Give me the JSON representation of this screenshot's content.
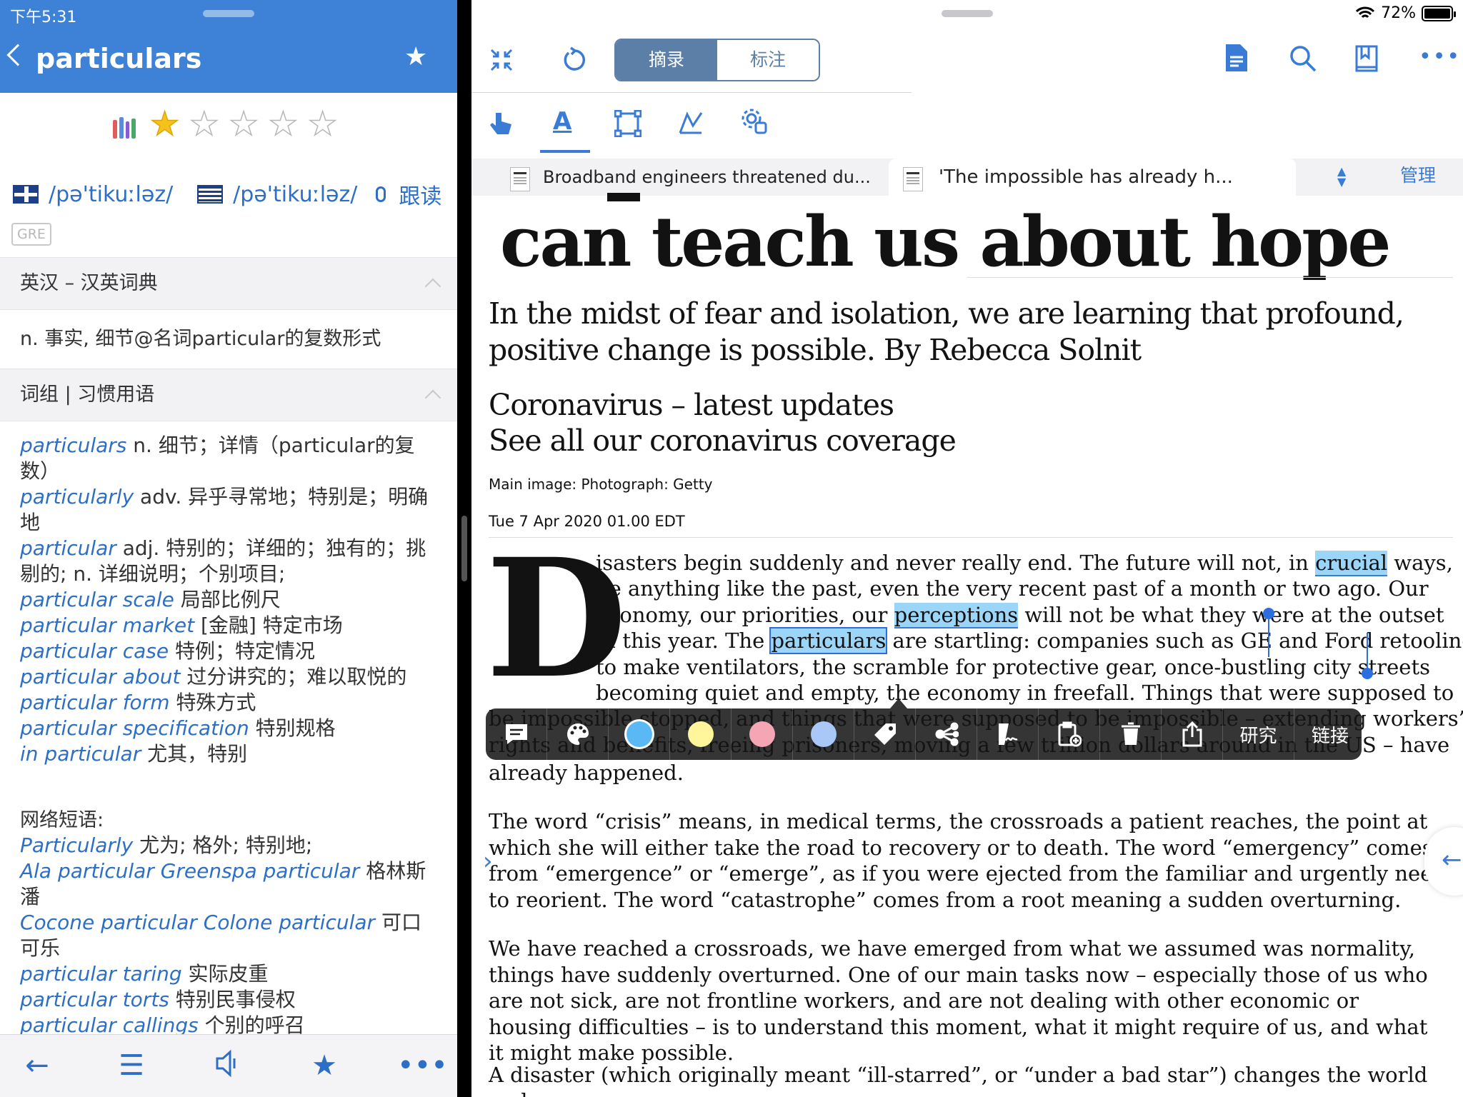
{
  "status": {
    "time": "下午5:31",
    "battery_text": "72%",
    "battery_level": 0.72
  },
  "dictionary": {
    "word": "particulars",
    "rating": 1,
    "rating_max": 5,
    "pronunciations": [
      {
        "region": "UK",
        "flag_icon": "uk-flag-icon",
        "ipa": "/pə'tikuːləz/"
      },
      {
        "region": "US",
        "flag_icon": "us-flag-icon",
        "ipa": "/pə'tikuːləz/"
      }
    ],
    "read_along_label": "跟读",
    "tag": "GRE",
    "section1_title": "英汉 – 汉英词典",
    "definition": "n. 事实, 细节@名词particular的复数形式",
    "section2_title": "词组 | 习惯用语",
    "phrases": [
      {
        "term": "particulars",
        "meaning": "n. 细节；详情（particular的复数）"
      },
      {
        "term": "particularly",
        "meaning": "adv. 异乎寻常地；特别是；明确地"
      },
      {
        "term": "particular",
        "meaning": "adj. 特别的；详细的；独有的；挑剔的; n. 详细说明；个别项目;"
      },
      {
        "term": "particular scale",
        "meaning": "局部比例尺"
      },
      {
        "term": "particular market",
        "meaning": "[金融] 特定市场"
      },
      {
        "term": "particular case",
        "meaning": "特例；特定情况"
      },
      {
        "term": "particular about",
        "meaning": "过分讲究的；难以取悦的"
      },
      {
        "term": "particular form",
        "meaning": "特殊方式"
      },
      {
        "term": "particular specification",
        "meaning": "特别规格"
      },
      {
        "term": "in particular",
        "meaning": "尤其，特别"
      }
    ],
    "web_title": "网络短语:",
    "web_phrases": [
      {
        "term": "Particularly",
        "meaning": "尤为; 格外; 特别地;"
      },
      {
        "term": "Ala particular Greenspa particular",
        "meaning": "格林斯潘"
      },
      {
        "term": "Cocone particular Colone particular",
        "meaning": "可口可乐"
      },
      {
        "term": "particular taring",
        "meaning": "实际皮重"
      },
      {
        "term": "particular torts",
        "meaning": "特别民事侵权"
      },
      {
        "term": "particular callings",
        "meaning": "个别的呼召"
      }
    ]
  },
  "reader": {
    "mode_tabs": [
      "摘录",
      "标注"
    ],
    "active_mode": "摘录",
    "tabs": [
      {
        "title": "Broadband engineers threatened du...",
        "active": false
      },
      {
        "title": "'The impossible has already h...",
        "active": true
      }
    ],
    "manage_label": "管理",
    "article": {
      "headline": "can teach us about hope",
      "standfirst": "In the midst of fear and isolation, we are learning that profound, positive change is possible. By Rebecca Solnit",
      "link1": "Coronavirus – latest updates",
      "link2": "See all our coronavirus coverage",
      "caption": "Main image: Photograph: Getty",
      "date": "Tue 7 Apr 2020 01.00 EDT",
      "dropcap": "D",
      "p1_lines": [
        {
          "pre": "isasters begin suddenly and never really end. The future will not, in ",
          "hl": "crucial",
          "post": " ways,"
        },
        {
          "pre": "be anything like the past, even the very recent past of a month or two ago. Our",
          "hl": "",
          "post": ""
        },
        {
          "pre": "economy, our priorities, our ",
          "hl": "perceptions",
          "post": " will not be what they were at the outset"
        },
        {
          "pre": "of this year. The ",
          "hl": "particulars",
          "post": " are startling: companies such as GE and Ford retooling"
        },
        {
          "pre": "to make ventilators, the scramble for protective gear, once-bustling city streets",
          "hl": "",
          "post": ""
        },
        {
          "pre": "becoming quiet and empty, the economy in freefall. Things that were supposed to",
          "hl": "",
          "post": ""
        },
        {
          "pre": "be impossible stopped, and things that were supposed to be impossible – extending workers’",
          "hl": "",
          "post": ""
        },
        {
          "pre": "rights and benefits, freeing prisoners, moving a few trillion dollars around in the US – have",
          "hl": "",
          "post": ""
        },
        {
          "pre": "already happened.",
          "hl": "",
          "post": ""
        }
      ],
      "p2": "The word “crisis” means, in medical terms, the crossroads a patient reaches, the point at which she will either take the road to recovery or to death. The word “emergency” comes from “emergence” or “emerge”, as if you were ejected from the familiar and urgently need to reorient. The word “catastrophe” comes from a root meaning a sudden overturning.",
      "p3": "We have reached a crossroads, we have emerged from what we assumed was normality, things have suddenly overturned. One of our main tasks now – especially those of us who are not sick, are not frontline workers, and are not dealing with other economic or housing difficulties – is to understand this moment, what it might require of us, and what it might make possible.",
      "p4": "A disaster (which originally meant “ill-starred”, or “under a bad star”) changes the world and"
    },
    "annotation_bar": {
      "research_label": "研究",
      "link_label": "链接",
      "swatches": [
        "#5ab8f5",
        "#fff59a",
        "#f4a6b5",
        "#a9c8f7"
      ],
      "selected_swatch": 0
    }
  },
  "colors": {
    "header_blue": "#3d82d6",
    "accent": "#3a7bd5",
    "highlight": "#9bd5f8"
  }
}
